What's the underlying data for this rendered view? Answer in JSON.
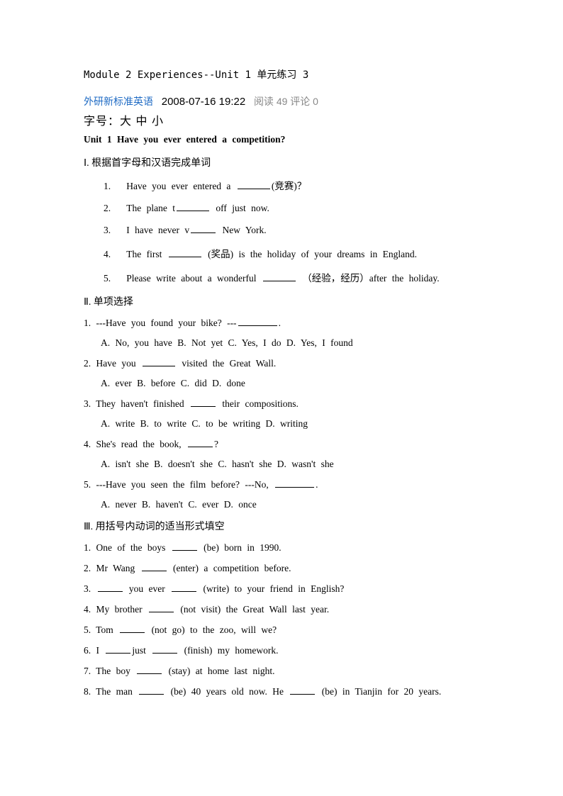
{
  "header": {
    "title": "Module 2 Experiences--Unit 1 单元练习 3",
    "link_text": "外研新标准英语",
    "date": "2008-07-16 19:22",
    "stats": "阅读 49  评论 0",
    "font_label": "字号：",
    "font_large": "大",
    "font_medium": "中",
    "font_small": "小"
  },
  "unit_title": "Unit 1 Have you ever entered a competition?",
  "section1": {
    "heading": "Ⅰ. 根据首字母和汉语完成单词",
    "items": [
      {
        "n": "1.",
        "before": "Have you ever entered a ",
        "after": "(竞赛)？"
      },
      {
        "n": "2.",
        "before": "The plane t",
        "after": " off just now."
      },
      {
        "n": "3.",
        "before": "I have never v",
        "after": " New York."
      },
      {
        "n": "4.",
        "before": "The first ",
        "after": " (奖品) is the holiday of your dreams in England."
      },
      {
        "n": "5.",
        "before": "Please write about a wonderful ",
        "after": " （经验，经历）after the holiday."
      }
    ]
  },
  "section2": {
    "heading": "Ⅱ. 单项选择",
    "items": [
      {
        "q": "1. ---Have you found your bike?   ---",
        "qafter": ".",
        "opts": "A. No, you have     B. Not yet    C. Yes, I do    D. Yes, I found"
      },
      {
        "q": "2. Have you ",
        "qafter": " visited the Great Wall.",
        "opts": "A. ever     B. before    C. did    D. done"
      },
      {
        "q": "3. They haven't finished ",
        "qafter": " their compositions.",
        "opts": "A. write     B. to write    C. to be writing    D. writing"
      },
      {
        "q": "4. She's read the book, ",
        "qafter": "?",
        "opts": "A. isn't she    B. doesn't she     C. hasn't she    D. wasn't she"
      },
      {
        "q": "5. ---Have you seen the film before?   ---No, ",
        "qafter": ".",
        "opts": "A. never     B. haven't    C. ever    D. once"
      }
    ]
  },
  "section3": {
    "heading": "Ⅲ. 用括号内动词的适当形式填空",
    "items": [
      {
        "before": "1. One of the boys ",
        "after": " (be) born in 1990."
      },
      {
        "before": "2. Mr Wang ",
        "after": " (enter) a competition before."
      },
      {
        "before": "3. ",
        "mid": " you ever ",
        "after": " (write) to your friend in English?"
      },
      {
        "before": "4. My brother ",
        "after": " (not visit) the Great Wall last year."
      },
      {
        "before": "5. Tom ",
        "after": " (not go) to the zoo, will we?"
      },
      {
        "before": "6. I ",
        "mid": "just ",
        "after": " (finish) my homework."
      },
      {
        "before": "7. The boy ",
        "after": " (stay) at home last night."
      },
      {
        "before": "8. The man ",
        "mid": " (be) 40 years old now. He ",
        "after": " (be) in Tianjin for 20 years."
      }
    ]
  }
}
